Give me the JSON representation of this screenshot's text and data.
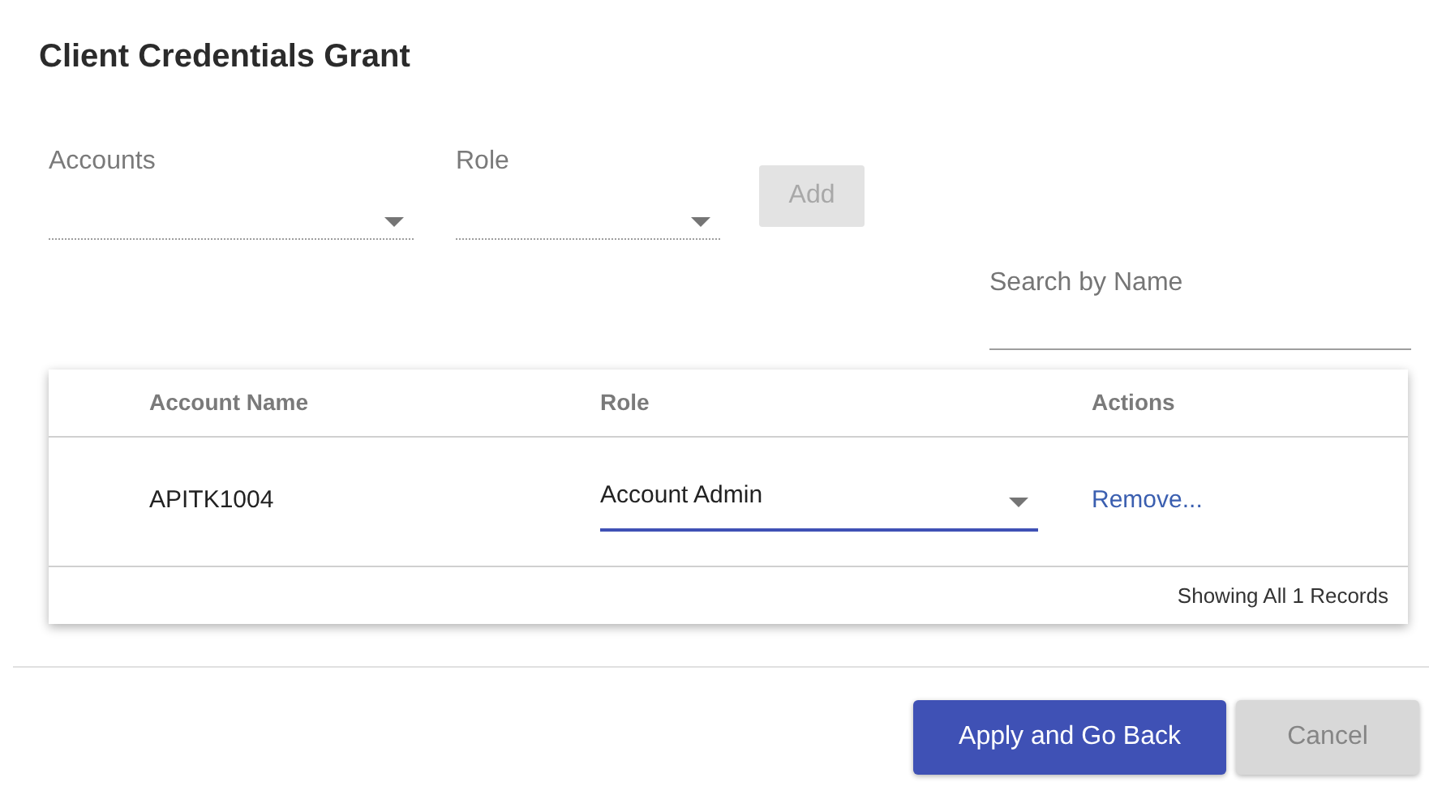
{
  "title": "Client Credentials Grant",
  "form": {
    "accounts": {
      "label": "Accounts"
    },
    "role": {
      "label": "Role"
    },
    "add_button": {
      "label": "Add",
      "disabled": true
    }
  },
  "search": {
    "placeholder": "Search by Name"
  },
  "table": {
    "columns": [
      "Account Name",
      "Role",
      "Actions"
    ],
    "rows": [
      {
        "account_name": "APITK1004",
        "role": "Account Admin",
        "action": "Remove..."
      }
    ],
    "footer": "Showing All 1 Records"
  },
  "buttons": [
    {
      "label": "Apply and Go Back",
      "kind": "primary",
      "disabled": false
    },
    {
      "label": "Cancel",
      "kind": "secondary",
      "disabled": true
    }
  ]
}
